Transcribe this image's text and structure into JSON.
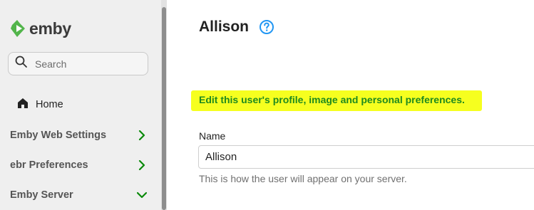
{
  "app": {
    "logo_text": "emby"
  },
  "sidebar": {
    "search_placeholder": "Search",
    "home_label": "Home",
    "sections": [
      {
        "label": "Emby Web Settings",
        "state": "collapsed"
      },
      {
        "label": "ebr Preferences",
        "state": "collapsed"
      },
      {
        "label": "Emby Server",
        "state": "expanded"
      }
    ]
  },
  "main": {
    "title": "Allison",
    "description": "Edit this user's profile, image and personal preferences.",
    "name_field": {
      "label": "Name",
      "value": "Allison",
      "helper": "This is how the user will appear on your server."
    }
  },
  "colors": {
    "brand_green": "#52b54b",
    "chevron_green": "#0a8a0a",
    "help_blue": "#2196f3",
    "highlight_yellow": "#f6ff1f",
    "description_green": "#1f8a1f"
  },
  "icons": {
    "logo": "emby-logo-icon",
    "search": "search-icon",
    "home": "home-icon",
    "collapsed": "chevron-right-icon",
    "expanded": "chevron-down-icon",
    "help": "help-circle-icon"
  }
}
